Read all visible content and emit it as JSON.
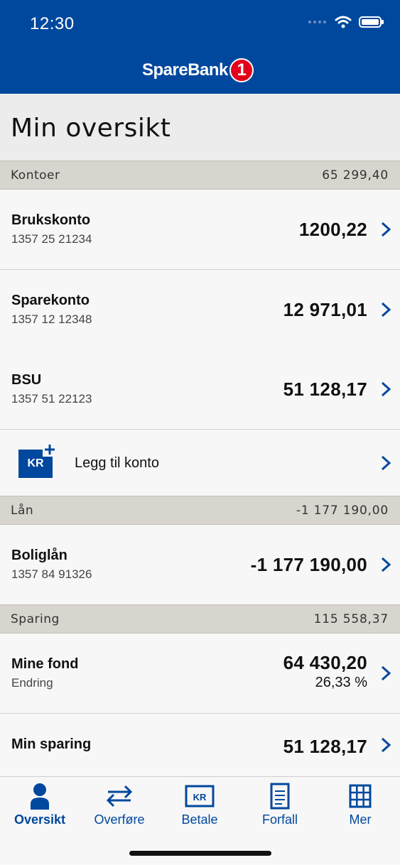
{
  "status": {
    "time": "12:30"
  },
  "brand": {
    "name": "SpareBank",
    "badge": "1"
  },
  "page": {
    "title": "Min oversikt"
  },
  "sections": {
    "kontoer": {
      "label": "Kontoer",
      "total": "65 299,40"
    },
    "lan": {
      "label": "Lån",
      "total": "-1 177 190,00"
    },
    "sparing": {
      "label": "Sparing",
      "total": "115 558,37"
    }
  },
  "accounts": [
    {
      "name": "Brukskonto",
      "number": "1357 25 21234",
      "amount": "1200,22"
    },
    {
      "name": "Sparekonto",
      "number": "1357 12 12348",
      "amount": "12 971,01"
    },
    {
      "name": "BSU",
      "number": "1357 51 22123",
      "amount": "51 128,17"
    }
  ],
  "add_account": {
    "icon_text": "KR",
    "label": "Legg til konto"
  },
  "loans": [
    {
      "name": "Boliglån",
      "number": "1357 84 91326",
      "amount": "-1 177 190,00"
    }
  ],
  "savings": [
    {
      "name": "Mine fond",
      "sub": "Endring",
      "amount": "64 430,20",
      "change": "26,33 %"
    },
    {
      "name": "Min sparing",
      "amount": "51 128,17"
    }
  ],
  "tabs": [
    {
      "label": "Oversikt",
      "icon": "person-icon",
      "active": true
    },
    {
      "label": "Overføre",
      "icon": "transfer-icon"
    },
    {
      "label": "Betale",
      "icon": "kr-card-icon",
      "icon_text": "KR"
    },
    {
      "label": "Forfall",
      "icon": "document-icon"
    },
    {
      "label": "Mer",
      "icon": "grid-icon"
    }
  ],
  "colors": {
    "brand_blue": "#00489d",
    "brand_red": "#e2001a",
    "section_bg": "#d8d5cf"
  }
}
